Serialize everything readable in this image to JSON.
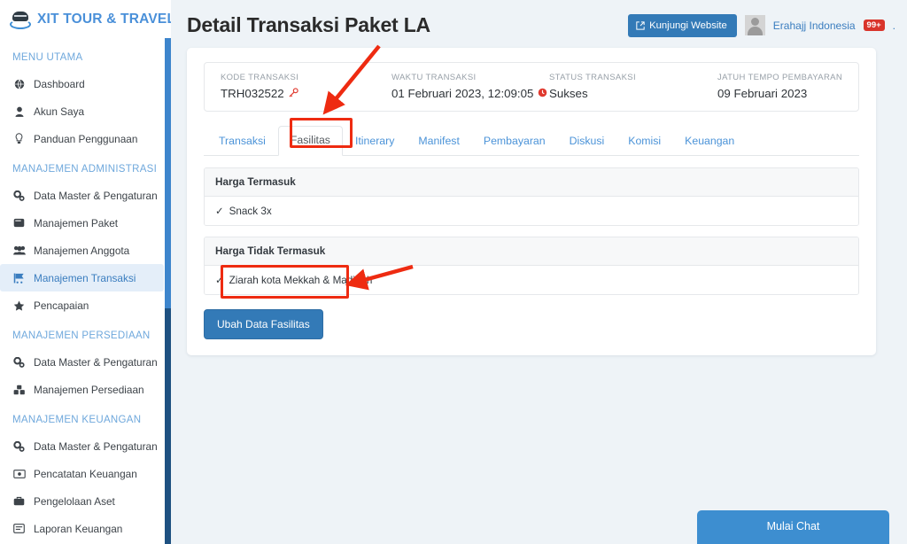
{
  "brand": {
    "name": "XIT TOUR & TRAVEL",
    "logo_icon": "bus-logo-icon"
  },
  "sidebar": {
    "groups": [
      {
        "heading": "MENU UTAMA",
        "items": [
          {
            "label": "Dashboard",
            "icon": "globe-icon",
            "active": false
          },
          {
            "label": "Akun Saya",
            "icon": "user-icon",
            "active": false
          },
          {
            "label": "Panduan Penggunaan",
            "icon": "lightbulb-icon",
            "active": false
          }
        ]
      },
      {
        "heading": "MANAJEMEN ADMINISTRASI",
        "items": [
          {
            "label": "Data Master & Pengaturan",
            "icon": "cogs-icon",
            "active": false
          },
          {
            "label": "Manajemen Paket",
            "icon": "book-icon",
            "active": false
          },
          {
            "label": "Manajemen Anggota",
            "icon": "users-icon",
            "active": false
          },
          {
            "label": "Manajemen Transaksi",
            "icon": "cart-flag-icon",
            "active": true
          },
          {
            "label": "Pencapaian",
            "icon": "star-badge-icon",
            "active": false
          }
        ]
      },
      {
        "heading": "MANAJEMEN PERSEDIAAN",
        "items": [
          {
            "label": "Data Master & Pengaturan",
            "icon": "cogs-icon",
            "active": false
          },
          {
            "label": "Manajemen Persediaan",
            "icon": "boxes-icon",
            "active": false
          }
        ]
      },
      {
        "heading": "MANAJEMEN KEUANGAN",
        "items": [
          {
            "label": "Data Master & Pengaturan",
            "icon": "cogs-icon",
            "active": false
          },
          {
            "label": "Pencatatan Keuangan",
            "icon": "money-bill-icon",
            "active": false
          },
          {
            "label": "Pengelolaan Aset",
            "icon": "briefcase-icon",
            "active": false
          },
          {
            "label": "Laporan Keuangan",
            "icon": "report-icon",
            "active": false
          }
        ]
      }
    ]
  },
  "header": {
    "title": "Detail Transaksi Paket LA",
    "visit_button": "Kunjungi Website",
    "visit_icon": "external-link-icon",
    "avatar_icon": "avatar-placeholder-icon",
    "user_name": "Erahajj Indonesia",
    "notification_badge": "99+",
    "trailing_dot": "."
  },
  "transaction_info": [
    {
      "label": "KODE TRANSAKSI",
      "value": "TRH032522",
      "icon": "key-icon"
    },
    {
      "label": "WAKTU TRANSAKSI",
      "value": "01 Februari 2023, 12:09:05",
      "icon": "clock-icon"
    },
    {
      "label": "STATUS TRANSAKSI",
      "value": "Sukses",
      "icon": ""
    },
    {
      "label": "JATUH TEMPO PEMBAYARAN",
      "value": "09 Februari 2023",
      "icon": ""
    }
  ],
  "tabs": [
    {
      "label": "Transaksi",
      "active": false
    },
    {
      "label": "Fasilitas",
      "active": true
    },
    {
      "label": "Itinerary",
      "active": false
    },
    {
      "label": "Manifest",
      "active": false
    },
    {
      "label": "Pembayaran",
      "active": false
    },
    {
      "label": "Diskusi",
      "active": false
    },
    {
      "label": "Komisi",
      "active": false
    },
    {
      "label": "Keuangan",
      "active": false
    }
  ],
  "facilities": {
    "sections": [
      {
        "title": "Harga Termasuk",
        "rows": [
          {
            "check": "✓",
            "text": "Snack 3x"
          }
        ]
      },
      {
        "title": "Harga Tidak Termasuk",
        "rows": [
          {
            "check": "✓",
            "text": "Ziarah kota Mekkah & Madinah"
          }
        ]
      }
    ],
    "edit_button": "Ubah Data Fasilitas"
  },
  "chat": {
    "label": "Mulai Chat"
  },
  "annotations": {
    "highlight_color": "#ee2b11",
    "items": [
      {
        "name": "arrow-to-fasilitas-tab"
      },
      {
        "name": "box-around-fasilitas-tab"
      },
      {
        "name": "box-around-ubah-data-fasilitas-button"
      },
      {
        "name": "arrow-to-ubah-data-fasilitas-button"
      }
    ]
  },
  "colors": {
    "brand_blue": "#4a90d9",
    "primary_button": "#337ab7",
    "active_nav_bg": "#e4eef9",
    "page_bg": "#eef3f7",
    "badge_red": "#d9342b",
    "annotation_red": "#ee2b11",
    "scrollbar_thumb": "#3d85cc",
    "scrollbar_track": "#1e5181"
  }
}
